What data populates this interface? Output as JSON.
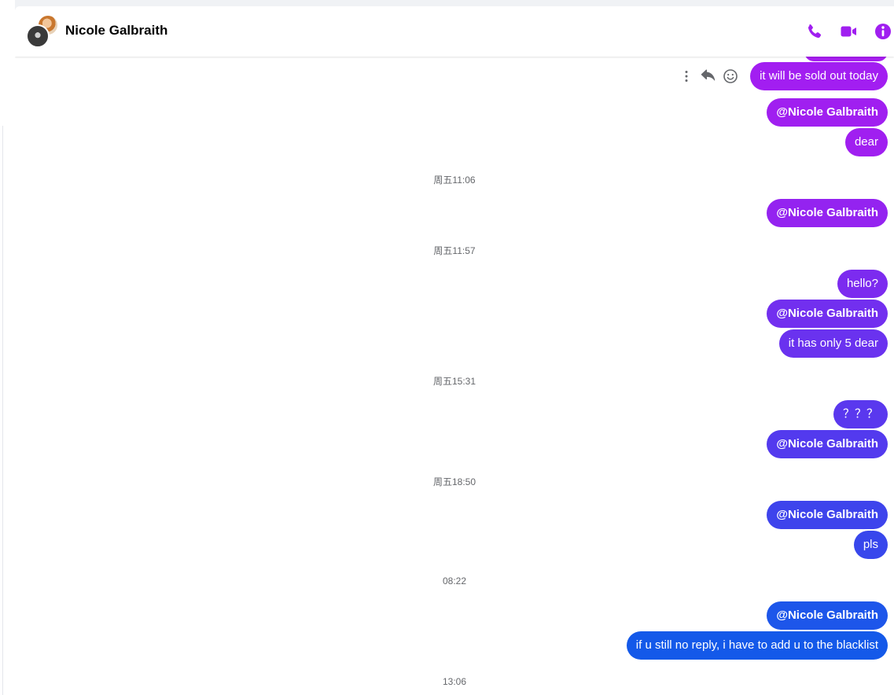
{
  "header": {
    "contact_name": "Nicole Galbraith",
    "icons": [
      "phone-icon",
      "video-camera-icon",
      "info-icon"
    ],
    "accent_color": "#a01ff0"
  },
  "hover_actions": [
    "more-options-icon",
    "reply-icon",
    "emoji-reaction-icon"
  ],
  "messages": [
    {
      "type": "bubble",
      "text": "it will be sold out today",
      "color": "#a21ef1"
    },
    {
      "type": "bubble",
      "text": "@Nicole Galbraith",
      "color": "#a01ff0",
      "bold": true
    },
    {
      "type": "bubble",
      "text": "dear",
      "color": "#a01ff0"
    },
    {
      "type": "time",
      "text": "周五11:06"
    },
    {
      "type": "bubble",
      "text": "@Nicole Galbraith",
      "color": "#9423f0",
      "bold": true
    },
    {
      "type": "time",
      "text": "周五11:57"
    },
    {
      "type": "bubble",
      "text": "hello?",
      "color": "#7c2bef"
    },
    {
      "type": "bubble",
      "text": "@Nicole Galbraith",
      "color": "#722fef",
      "bold": true
    },
    {
      "type": "bubble",
      "text": "it has only 5 dear",
      "color": "#6a32ef"
    },
    {
      "type": "time",
      "text": "周五15:31"
    },
    {
      "type": "bubble",
      "text": "？？？",
      "color": "#5a38ee"
    },
    {
      "type": "bubble",
      "text": "@Nicole Galbraith",
      "color": "#533aee",
      "bold": true
    },
    {
      "type": "time",
      "text": "周五18:50"
    },
    {
      "type": "bubble",
      "text": "@Nicole Galbraith",
      "color": "#3e44ec",
      "bold": true
    },
    {
      "type": "bubble",
      "text": "pls",
      "color": "#3847ec"
    },
    {
      "type": "time",
      "text": "08:22"
    },
    {
      "type": "bubble",
      "text": "@Nicole Galbraith",
      "color": "#1d56ea",
      "bold": true
    },
    {
      "type": "bubble",
      "text": "if u still no reply, i have to add u to the blacklist",
      "color": "#1459e9"
    },
    {
      "type": "time",
      "text": "13:06"
    }
  ]
}
